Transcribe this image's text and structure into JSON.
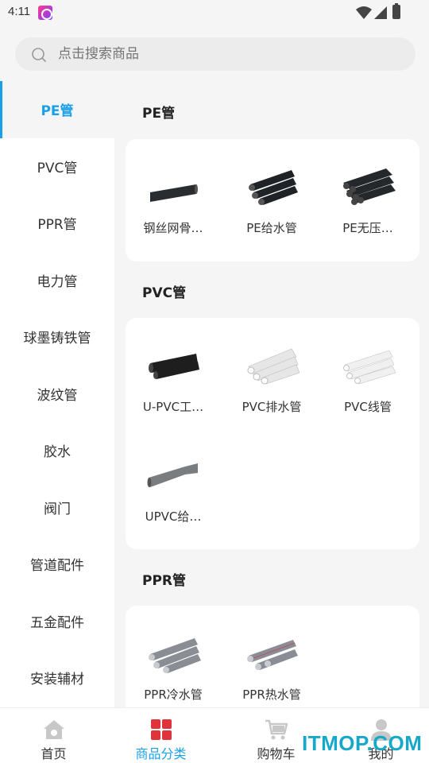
{
  "status_bar": {
    "time": "4:11"
  },
  "search": {
    "placeholder": "点击搜索商品"
  },
  "sidebar": {
    "items": [
      {
        "label": "PE管"
      },
      {
        "label": "PVC管"
      },
      {
        "label": "PPR管"
      },
      {
        "label": "电力管"
      },
      {
        "label": "球墨铸铁管"
      },
      {
        "label": "波纹管"
      },
      {
        "label": "胶水"
      },
      {
        "label": "阀门"
      },
      {
        "label": "管道配件"
      },
      {
        "label": "五金配件"
      },
      {
        "label": "安装辅材"
      }
    ]
  },
  "sections": [
    {
      "title": "PE管",
      "products": [
        {
          "name": "钢丝网骨…",
          "color": "#2a2d30"
        },
        {
          "name": "PE给水管",
          "color": "#1f2226"
        },
        {
          "name": "PE无压…",
          "color": "#25282b"
        }
      ]
    },
    {
      "title": "PVC管",
      "products": [
        {
          "name": "U-PVC工…",
          "color": "#1e1e1e"
        },
        {
          "name": "PVC排水管",
          "color": "#e6e6e6"
        },
        {
          "name": "PVC线管",
          "color": "#f0f0f0"
        },
        {
          "name": "UPVC给…",
          "color": "#7a7d80"
        }
      ]
    },
    {
      "title": "PPR管",
      "products": [
        {
          "name": "PPR冷水管",
          "color": "#8a8e94"
        },
        {
          "name": "PPR热水管",
          "color": "#8a8c96"
        }
      ]
    }
  ],
  "tabbar": {
    "tabs": [
      {
        "label": "首页",
        "icon": "home-icon"
      },
      {
        "label": "商品分类",
        "icon": "category-icon"
      },
      {
        "label": "购物车",
        "icon": "cart-icon"
      },
      {
        "label": "我的",
        "icon": "user-icon"
      }
    ],
    "active_color": "#1aa0e8"
  },
  "watermark": "ITMOP.COM"
}
